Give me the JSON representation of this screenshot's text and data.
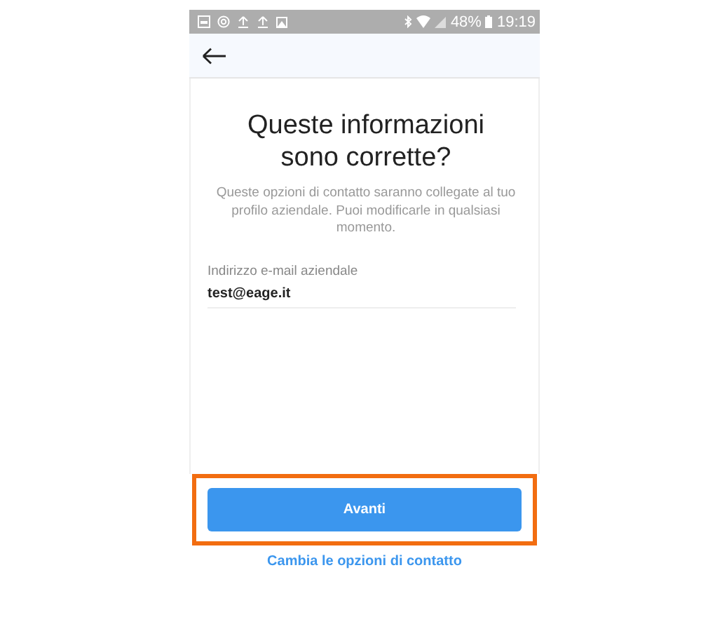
{
  "status_bar": {
    "battery": "48%",
    "time": "19:19"
  },
  "title": "Queste informazioni sono corrette?",
  "description": "Queste opzioni di contatto saranno collegate al tuo profilo aziendale. Puoi modificarle in qualsiasi momento.",
  "email_field": {
    "label": "Indirizzo e-mail aziendale",
    "value": "test@eage.it"
  },
  "next_button": {
    "label": "Avanti",
    "highlighted": true
  },
  "change_link": "Cambia le opzioni di contatto"
}
